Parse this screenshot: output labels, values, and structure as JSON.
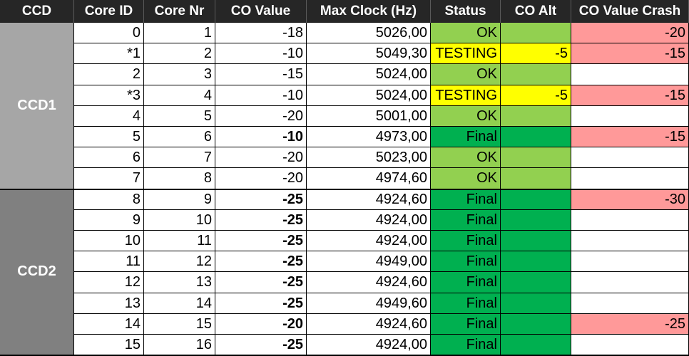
{
  "headers": [
    "CCD",
    "Core ID",
    "Core Nr",
    "CO Value",
    "Max Clock (Hz)",
    "Status",
    "CO Alt",
    "CO Value Crash"
  ],
  "groups": [
    {
      "label": "CCD1",
      "color": "#a6a6a6",
      "rows": 8
    },
    {
      "label": "CCD2",
      "color": "#808080",
      "rows": 8
    }
  ],
  "status_colors": {
    "OK": "#92d050",
    "TESTING": "#ffff00",
    "Final": "#00b050",
    "crash": "#ff9999"
  },
  "rows": [
    {
      "core_id": "0",
      "core_nr": "1",
      "co_value": "-18",
      "co_bold": false,
      "max_clock": "5026,00",
      "status": "OK",
      "co_alt": "",
      "co_crash": "-20"
    },
    {
      "core_id": "*1",
      "core_nr": "2",
      "co_value": "-10",
      "co_bold": false,
      "max_clock": "5049,30",
      "status": "TESTING",
      "co_alt": "-5",
      "co_crash": "-15"
    },
    {
      "core_id": "2",
      "core_nr": "3",
      "co_value": "-15",
      "co_bold": false,
      "max_clock": "5024,00",
      "status": "OK",
      "co_alt": "",
      "co_crash": ""
    },
    {
      "core_id": "*3",
      "core_nr": "4",
      "co_value": "-10",
      "co_bold": false,
      "max_clock": "5024,00",
      "status": "TESTING",
      "co_alt": "-5",
      "co_crash": "-15"
    },
    {
      "core_id": "4",
      "core_nr": "5",
      "co_value": "-20",
      "co_bold": false,
      "max_clock": "5001,00",
      "status": "OK",
      "co_alt": "",
      "co_crash": ""
    },
    {
      "core_id": "5",
      "core_nr": "6",
      "co_value": "-10",
      "co_bold": true,
      "max_clock": "4973,00",
      "status": "Final",
      "co_alt": "",
      "co_crash": "-15"
    },
    {
      "core_id": "6",
      "core_nr": "7",
      "co_value": "-20",
      "co_bold": false,
      "max_clock": "5023,00",
      "status": "OK",
      "co_alt": "",
      "co_crash": ""
    },
    {
      "core_id": "7",
      "core_nr": "8",
      "co_value": "-20",
      "co_bold": false,
      "max_clock": "4974,60",
      "status": "OK",
      "co_alt": "",
      "co_crash": ""
    },
    {
      "core_id": "8",
      "core_nr": "9",
      "co_value": "-25",
      "co_bold": true,
      "max_clock": "4924,60",
      "status": "Final",
      "co_alt": "",
      "co_crash": "-30"
    },
    {
      "core_id": "9",
      "core_nr": "10",
      "co_value": "-25",
      "co_bold": true,
      "max_clock": "4924,00",
      "status": "Final",
      "co_alt": "",
      "co_crash": ""
    },
    {
      "core_id": "10",
      "core_nr": "11",
      "co_value": "-25",
      "co_bold": true,
      "max_clock": "4924,00",
      "status": "Final",
      "co_alt": "",
      "co_crash": ""
    },
    {
      "core_id": "11",
      "core_nr": "12",
      "co_value": "-25",
      "co_bold": true,
      "max_clock": "4949,00",
      "status": "Final",
      "co_alt": "",
      "co_crash": ""
    },
    {
      "core_id": "12",
      "core_nr": "13",
      "co_value": "-25",
      "co_bold": true,
      "max_clock": "4924,60",
      "status": "Final",
      "co_alt": "",
      "co_crash": ""
    },
    {
      "core_id": "13",
      "core_nr": "14",
      "co_value": "-25",
      "co_bold": true,
      "max_clock": "4949,60",
      "status": "Final",
      "co_alt": "",
      "co_crash": ""
    },
    {
      "core_id": "14",
      "core_nr": "15",
      "co_value": "-20",
      "co_bold": true,
      "max_clock": "4924,60",
      "status": "Final",
      "co_alt": "",
      "co_crash": "-25"
    },
    {
      "core_id": "15",
      "core_nr": "16",
      "co_value": "-25",
      "co_bold": true,
      "max_clock": "4924,00",
      "status": "Final",
      "co_alt": "",
      "co_crash": ""
    }
  ]
}
